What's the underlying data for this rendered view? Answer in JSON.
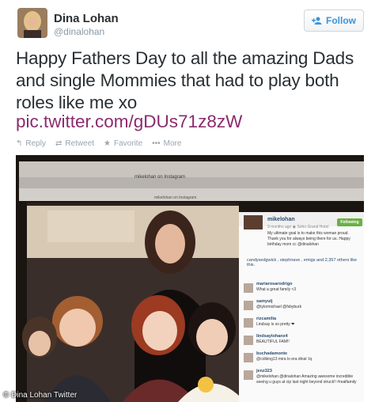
{
  "tweet": {
    "display_name": "Dina Lohan",
    "handle": "@dinalohan",
    "follow_label": "Follow",
    "text": "Happy Fathers Day to all the amazing Dads and single Mommies that had to play both roles like me xo",
    "link": "pic.twitter.com/gDUs71z8zW",
    "actions": {
      "reply": "Reply",
      "retweet": "Retweet",
      "favorite": "Favorite",
      "more": "More"
    }
  },
  "photo": {
    "window_title": "mikelohan on Instagram",
    "url": "mikelohan on Instagram",
    "instagram": {
      "username": "mikelohan",
      "follow_label": "Following",
      "time_location": "9 months ago  ◉ Soho Grand Hotel",
      "caption": "My ultimate goal is to make this woman proud. Thank you for always being there for us. Happy birthday mom cc @dinalohan",
      "likes": "candysedgwick , stephnave , emigs and 2,357 others like this.",
      "comments": [
        {
          "user": "mariarosarodrigo",
          "text": "What a great family <3"
        },
        {
          "user": "samyulj",
          "text": "@tylormichael @fsbyburk"
        },
        {
          "user": "rizcamilia",
          "text": "Lindsay is so pretty ❤"
        },
        {
          "user": "lindsaylohanx4",
          "text": "BEAUTIFUL FAM!!"
        },
        {
          "user": "buchadamonte",
          "text": "@colbing13 mira lo era dinal :lq"
        },
        {
          "user": "jenz323",
          "text": "@mikelohan @dinalohan Amazing awesome incredible seeing u guys at cip last night beyond struck!! #realfamily"
        }
      ]
    }
  },
  "watermark": "© Dina Lohan Twitter",
  "colors": {
    "link": "#8b2b6e",
    "follow": "#3b94d9",
    "muted": "#8899a6"
  }
}
